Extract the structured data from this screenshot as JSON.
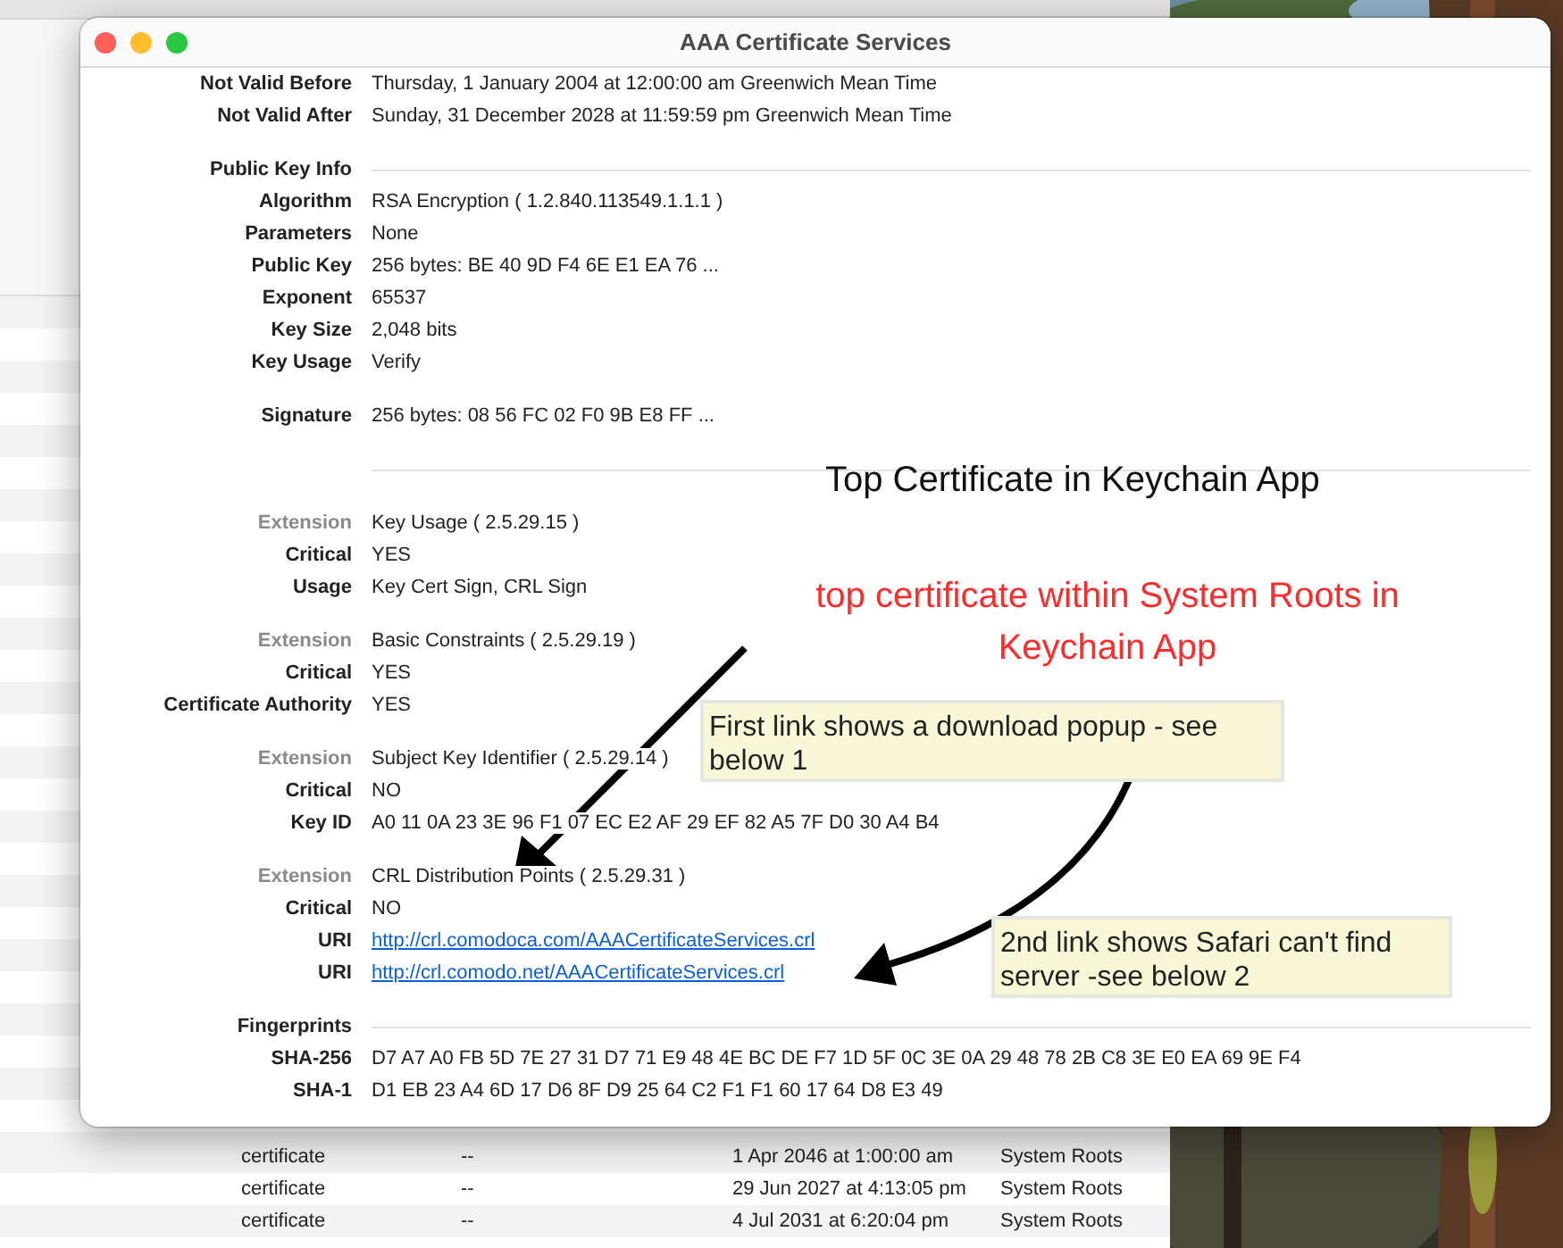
{
  "window": {
    "title": "AAA Certificate Services"
  },
  "groups": [
    {
      "kind": "fields",
      "rows": [
        {
          "kind": "field",
          "label": "Not Valid Before",
          "value": "Thursday, 1 January 2004 at 12:00:00 am Greenwich Mean Time"
        },
        {
          "kind": "field",
          "label": "Not Valid After",
          "value": "Sunday, 31 December 2028 at 11:59:59 pm Greenwich Mean Time"
        }
      ]
    },
    {
      "kind": "section",
      "heading": "Public Key Info",
      "rows": [
        {
          "kind": "field",
          "label": "Algorithm",
          "value": "RSA Encryption ( 1.2.840.113549.1.1.1 )"
        },
        {
          "kind": "field",
          "label": "Parameters",
          "value": "None"
        },
        {
          "kind": "field",
          "label": "Public Key",
          "value": "256 bytes: BE 40 9D F4 6E E1 EA 76 ..."
        },
        {
          "kind": "field",
          "label": "Exponent",
          "value": "65537"
        },
        {
          "kind": "field",
          "label": "Key Size",
          "value": "2,048 bits"
        },
        {
          "kind": "field",
          "label": "Key Usage",
          "value": "Verify"
        }
      ]
    },
    {
      "kind": "fields",
      "rows": [
        {
          "kind": "field",
          "label": "Signature",
          "value": "256 bytes: 08 56 FC 02 F0 9B E8 FF ..."
        }
      ]
    },
    {
      "kind": "divider"
    },
    {
      "kind": "fields",
      "rows": [
        {
          "kind": "extension",
          "label": "Extension",
          "value": "Key Usage ( 2.5.29.15 )"
        },
        {
          "kind": "field",
          "label": "Critical",
          "value": "YES"
        },
        {
          "kind": "field",
          "label": "Usage",
          "value": "Key Cert Sign, CRL Sign"
        }
      ]
    },
    {
      "kind": "fields",
      "rows": [
        {
          "kind": "extension",
          "label": "Extension",
          "value": "Basic Constraints ( 2.5.29.19 )"
        },
        {
          "kind": "field",
          "label": "Critical",
          "value": "YES"
        },
        {
          "kind": "field",
          "label": "Certificate Authority",
          "value": "YES"
        }
      ]
    },
    {
      "kind": "fields",
      "rows": [
        {
          "kind": "extension",
          "label": "Extension",
          "value": "Subject Key Identifier ( 2.5.29.14 )"
        },
        {
          "kind": "field",
          "label": "Critical",
          "value": "NO"
        },
        {
          "kind": "field",
          "label": "Key ID",
          "value": "A0 11 0A 23 3E 96 F1 07 EC E2 AF 29 EF 82 A5 7F D0 30 A4 B4"
        }
      ]
    },
    {
      "kind": "fields",
      "rows": [
        {
          "kind": "extension",
          "label": "Extension",
          "value": "CRL Distribution Points ( 2.5.29.31 )"
        },
        {
          "kind": "field",
          "label": "Critical",
          "value": "NO"
        },
        {
          "kind": "link",
          "label": "URI",
          "value": "http://crl.comodoca.com/AAACertificateServices.crl"
        },
        {
          "kind": "link",
          "label": "URI",
          "value": "http://crl.comodo.net/AAACertificateServices.crl"
        }
      ]
    },
    {
      "kind": "section",
      "heading": "Fingerprints",
      "rows": [
        {
          "kind": "field",
          "label": "SHA-256",
          "value": "D7 A7 A0 FB 5D 7E 27 31 D7 71 E9 48 4E BC DE F7 1D 5F 0C 3E 0A 29 48 78 2B C8 3E E0 EA 69 9E F4"
        },
        {
          "kind": "field",
          "label": "SHA-1",
          "value": "D1 EB 23 A4 6D 17 D6 8F D9 25 64 C2 F1 F1 60 17 64 D8 E3 49"
        }
      ]
    }
  ],
  "background_list": {
    "rows": [
      {
        "cells": [
          "certificate",
          "--",
          "1 Apr 2046 at 1:00:00 am",
          "System Roots"
        ]
      },
      {
        "cells": [
          "certificate",
          "--",
          "29 Jun 2027 at 4:13:05 pm",
          "System Roots"
        ]
      },
      {
        "cells": [
          "certificate",
          "--",
          "4 Jul 2031 at 6:20:04 pm",
          "System Roots"
        ]
      }
    ]
  },
  "annotations": [
    {
      "kind": "heading",
      "text": "Top Certificate in Keychain App"
    },
    {
      "kind": "emphasis",
      "text": "top certificate within System Roots in Keychain App"
    },
    {
      "kind": "note",
      "text": "First link shows a download popup - see below 1"
    },
    {
      "kind": "note",
      "text": "2nd link shows Safari can't find server -see below 2"
    }
  ]
}
